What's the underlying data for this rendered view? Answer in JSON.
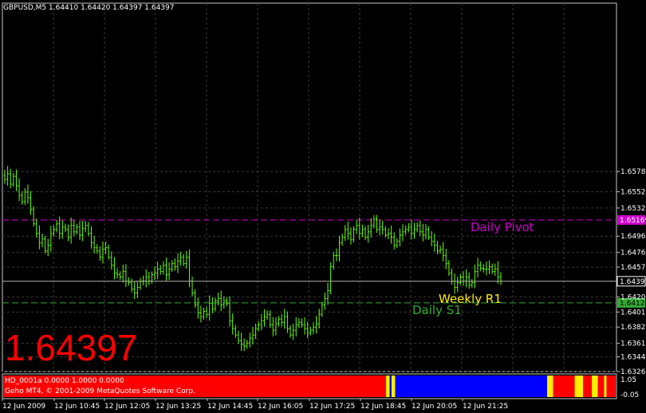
{
  "chart_data": {
    "type": "ohlc",
    "title": "GBPUSD,M5  1.64410 1.64420 1.64397 1.64397",
    "ylim": [
      1.6326,
      1.679
    ],
    "y_ticks": [
      "1.65780",
      "1.65525",
      "1.65320",
      "1.64965",
      "1.64760",
      "1.64575",
      "1.64397",
      "1.64200",
      "1.64010",
      "1.63820",
      "1.63615",
      "1.63445",
      "1.63260"
    ],
    "x_tick_labels": [
      "12 Jun 2009",
      "12 Jun 10:45",
      "12 Jun 12:05",
      "12 Jun 13:25",
      "12 Jun 14:45",
      "12 Jun 16:05",
      "12 Jun 17:25",
      "12 Jun 18:45",
      "12 Jun 20:05",
      "12 Jun 21:25"
    ],
    "close_series": [
      1.6568,
      1.6575,
      1.6562,
      1.6572,
      1.656,
      1.6548,
      1.654,
      1.6552,
      1.6545,
      1.653,
      1.6512,
      1.65,
      1.6488,
      1.6493,
      1.6478,
      1.6485,
      1.65,
      1.6505,
      1.6512,
      1.65,
      1.6508,
      1.6505,
      1.6495,
      1.651,
      1.6502,
      1.6508,
      1.6498,
      1.6506,
      1.651,
      1.65,
      1.6488,
      1.6482,
      1.6478,
      1.647,
      1.648,
      1.6482,
      1.647,
      1.646,
      1.645,
      1.6448,
      1.6445,
      1.6452,
      1.644,
      1.6438,
      1.643,
      1.6425,
      1.6432,
      1.644,
      1.644,
      1.6445,
      1.644,
      1.6448,
      1.645,
      1.6455,
      1.6452,
      1.646,
      1.6448,
      1.6455,
      1.6462,
      1.6458,
      1.6465,
      1.647,
      1.6462,
      1.647,
      1.644,
      1.6425,
      1.641,
      1.64,
      1.6395,
      1.6402,
      1.6398,
      1.6412,
      1.6405,
      1.6415,
      1.6418,
      1.641,
      1.6415,
      1.6412,
      1.639,
      1.638,
      1.6372,
      1.6365,
      1.636,
      1.6358,
      1.6362,
      1.6368,
      1.6372,
      1.638,
      1.6385,
      1.639,
      1.6395,
      1.6398,
      1.6385,
      1.6378,
      1.6386,
      1.6392,
      1.6388,
      1.6395,
      1.638,
      1.6372,
      1.6378,
      1.6385,
      1.6388,
      1.6385,
      1.638,
      1.6375,
      1.6378,
      1.6382,
      1.6386,
      1.6398,
      1.641,
      1.6418,
      1.6428,
      1.6458,
      1.6472,
      1.6472,
      1.6488,
      1.6495,
      1.6505,
      1.65,
      1.6492,
      1.6505,
      1.651,
      1.65,
      1.6505,
      1.6495,
      1.6502,
      1.651,
      1.6518,
      1.6505,
      1.6508,
      1.6505,
      1.6498,
      1.65,
      1.6495,
      1.6485,
      1.649,
      1.6498,
      1.6502,
      1.6505,
      1.6508,
      1.65,
      1.6505,
      1.651,
      1.6502,
      1.6498,
      1.6505,
      1.6495,
      1.649,
      1.6485,
      1.6478,
      1.648,
      1.6472,
      1.6462,
      1.645,
      1.644,
      1.6432,
      1.6438,
      1.6445,
      1.644,
      1.6445,
      1.6435,
      1.6438,
      1.6452,
      1.646,
      1.6456,
      1.6455,
      1.6455,
      1.6458,
      1.6452,
      1.6455,
      1.6445,
      1.644
    ],
    "price_levels": [
      {
        "name": "Daily Pivot",
        "price_label": "1.65169",
        "value": 1.65169,
        "color": "#cc00cc",
        "style": "dashed"
      },
      {
        "name": "Weekly R1",
        "price_label": "",
        "value": 1.64397,
        "color": "#ffee00",
        "style": "none"
      },
      {
        "name": "Daily S1",
        "price_label": "1.64125",
        "value": 1.64125,
        "color": "#33aa33",
        "style": "dashed"
      }
    ],
    "current_price": "1.64397",
    "grid": true,
    "candle_color": "#66ff00",
    "background": "#000000"
  },
  "big_price": "1.64397",
  "indicator": {
    "line1": "HD_0001a 0.0000 1.0000 0.0000",
    "line2": "Geho MT4, © 2001-2009 MetaQuotes Software Corp.",
    "y_ticks": [
      "1.05",
      "-0.05"
    ],
    "segments": [
      {
        "color": "#ff0000",
        "span": 0.625
      },
      {
        "color": "#ffee00",
        "span": 0.006
      },
      {
        "color": "#0000ff",
        "span": 0.003
      },
      {
        "color": "#ffee00",
        "span": 0.006
      },
      {
        "color": "#0000ff",
        "span": 0.248
      },
      {
        "color": "#ffee00",
        "span": 0.01
      },
      {
        "color": "#ff0000",
        "span": 0.035
      },
      {
        "color": "#ffee00",
        "span": 0.014
      },
      {
        "color": "#ff0000",
        "span": 0.014
      },
      {
        "color": "#ffee00",
        "span": 0.01
      },
      {
        "color": "#ff0000",
        "span": 0.01
      },
      {
        "color": "#ffee00",
        "span": 0.004
      },
      {
        "color": "#ff0000",
        "span": 0.015
      }
    ]
  }
}
